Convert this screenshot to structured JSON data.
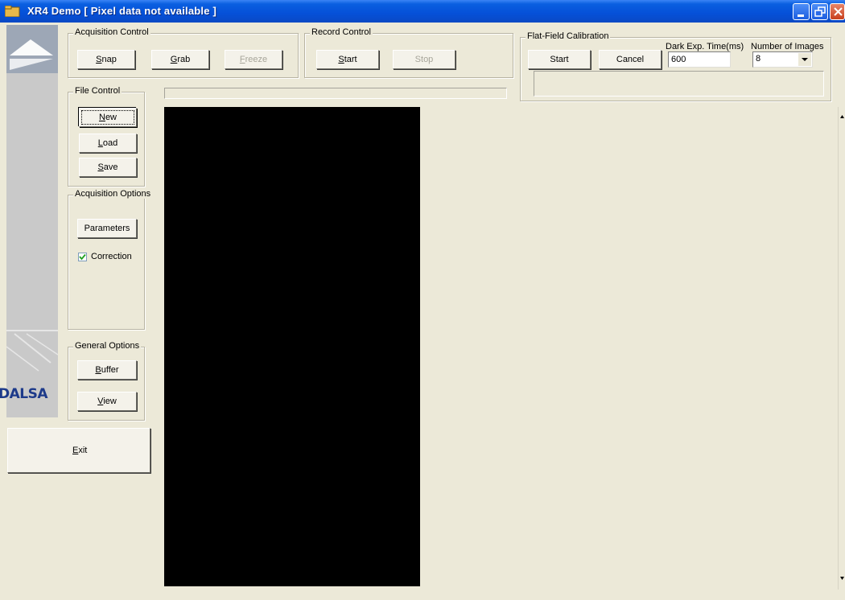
{
  "window": {
    "title": "XR4 Demo  [ Pixel data not available ]",
    "controls": [
      "minimize",
      "restore",
      "close"
    ]
  },
  "branding": {
    "logo_text": "DALSA"
  },
  "acquisition_control": {
    "label": "Acquisition Control",
    "snap": {
      "pre": "",
      "key": "S",
      "post": "nap"
    },
    "grab": {
      "pre": "",
      "key": "G",
      "post": "rab"
    },
    "freeze": {
      "pre": "",
      "key": "F",
      "post": "reeze",
      "enabled": false
    }
  },
  "record_control": {
    "label": "Record Control",
    "start": {
      "pre": "",
      "key": "S",
      "post": "tart"
    },
    "stop": {
      "label": "Stop",
      "enabled": false
    }
  },
  "flat_field": {
    "label": "Flat-Field Calibration",
    "start_label": "Start",
    "cancel_label": "Cancel",
    "dark_exp_label": "Dark Exp. Time(ms)",
    "dark_exp_value": "600",
    "num_images_label": "Number of Images",
    "num_images_value": "8",
    "status_text": ""
  },
  "file_control": {
    "label": "File Control",
    "new": {
      "pre": "",
      "key": "N",
      "post": "ew"
    },
    "load": {
      "pre": "",
      "key": "L",
      "post": "oad"
    },
    "save": {
      "pre": "",
      "key": "S",
      "post": "ave"
    }
  },
  "acquisition_options": {
    "label": "Acquisition Options",
    "parameters_label": "Parameters",
    "correction_label": "Correction",
    "correction_checked": true
  },
  "general_options": {
    "label": "General Options",
    "buffer": {
      "pre": "",
      "key": "B",
      "post": "uffer"
    },
    "view": {
      "pre": "",
      "key": "V",
      "post": "iew"
    }
  },
  "exit": {
    "pre": "",
    "key": "E",
    "post": "xit"
  },
  "status_bar_text": ""
}
